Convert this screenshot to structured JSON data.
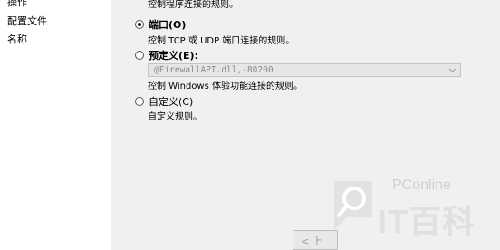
{
  "sidebar": {
    "items": [
      {
        "label": "操作"
      },
      {
        "label": "配置文件"
      },
      {
        "label": "名称"
      }
    ]
  },
  "main": {
    "program_description": "控制程序连接的规则。",
    "options": [
      {
        "label": "端口(O)",
        "description": "控制 TCP 或 UDP 端口连接的规则。",
        "checked": true
      },
      {
        "label": "预定义(E):",
        "description": "控制 Windows 体验功能连接的规则。",
        "checked": false
      },
      {
        "label": "自定义(C)",
        "description": "自定义规则。",
        "checked": false
      }
    ],
    "predefined_dropdown": {
      "value": "@FirewallAPI.dll,-80200",
      "enabled": false
    }
  },
  "footer": {
    "back_button_label": "< 上"
  },
  "watermark": {
    "brand": "PConline",
    "logo_text": "IT百科",
    "color": "#dcdcdc"
  },
  "colors": {
    "sidebar_bg": "#ffffff",
    "main_bg": "#f0f0f0",
    "disabled_text": "#8a8a8a"
  }
}
